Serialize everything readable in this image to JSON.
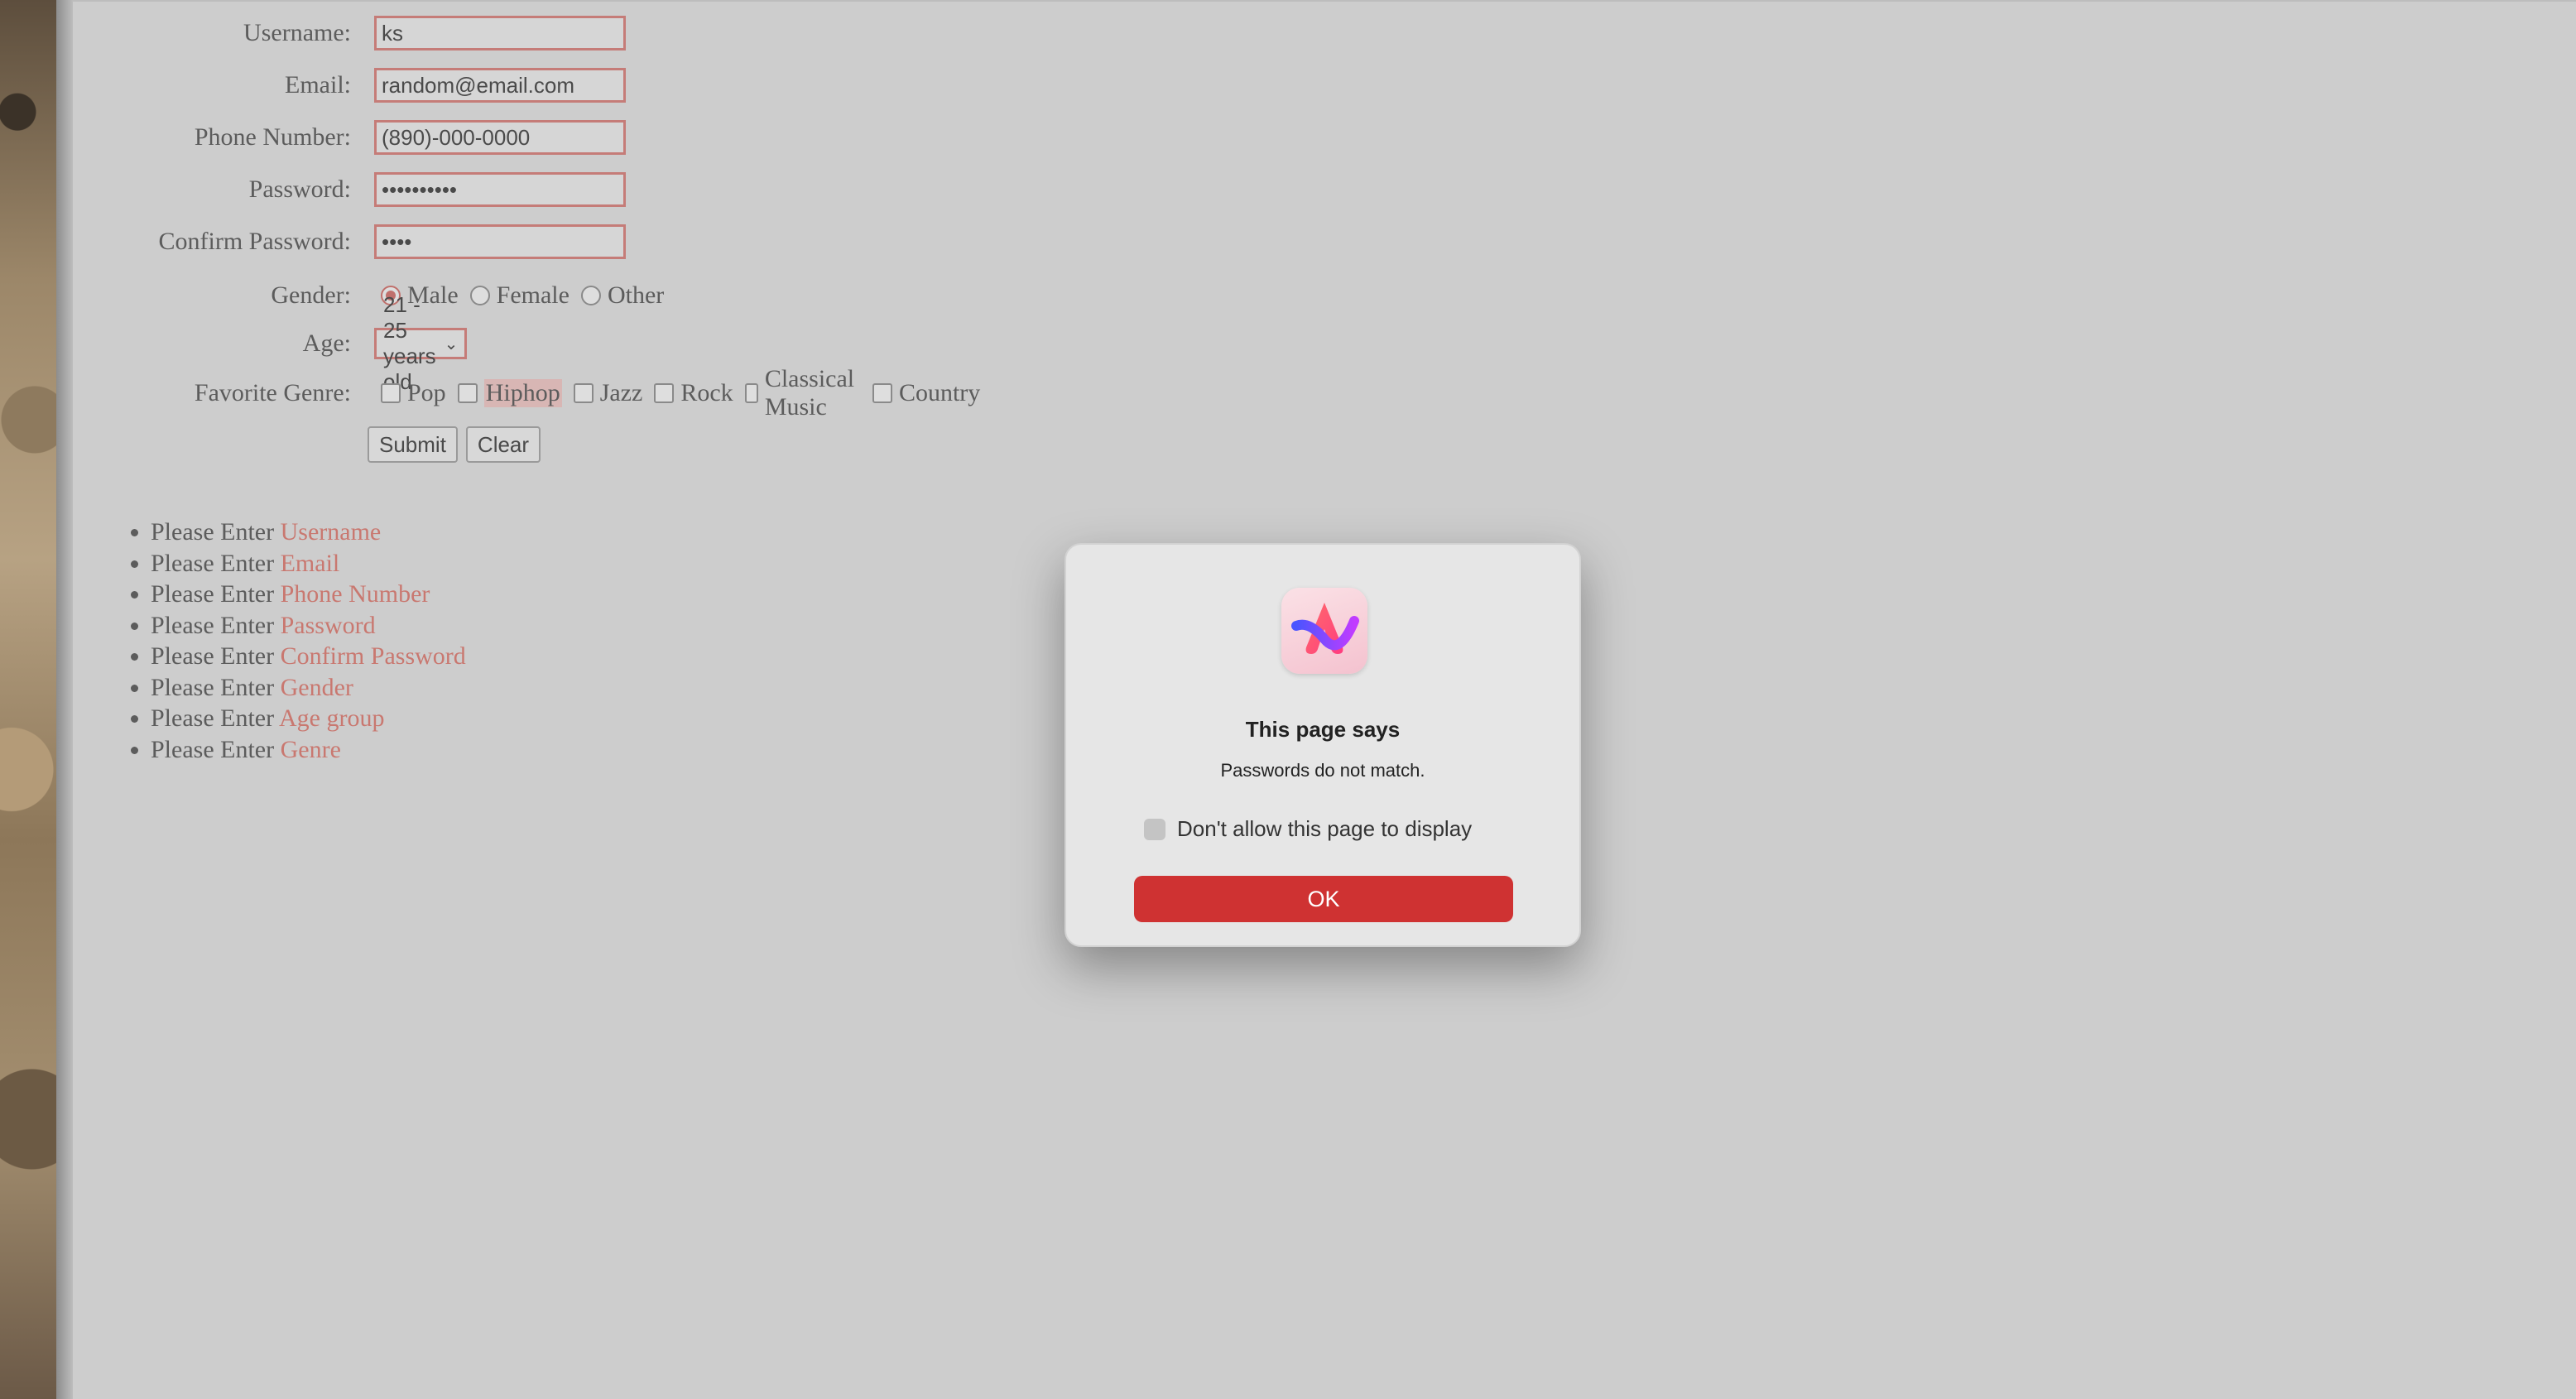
{
  "form": {
    "username_label": "Username:",
    "username_value": "ks",
    "email_label": "Email:",
    "email_value": "random@email.com",
    "phone_label": "Phone Number:",
    "phone_value": "(890)-000-0000",
    "password_label": "Password:",
    "password_value": "••••••••••",
    "confirm_label": "Confirm Password:",
    "confirm_value": "••••",
    "gender_label": "Gender:",
    "gender_options": [
      "Male",
      "Female",
      "Other"
    ],
    "gender_selected": "Male",
    "age_label": "Age:",
    "age_value": "21 - 25 years old",
    "genre_label": "Favorite Genre:",
    "genre_options": [
      "Pop",
      "Hiphop",
      "Jazz",
      "Rock",
      "Classical Music",
      "Country"
    ],
    "submit_label": "Submit",
    "clear_label": "Clear"
  },
  "errors": {
    "prefix": "Please Enter",
    "items": [
      "Username",
      "Email",
      "Phone Number",
      "Password",
      "Confirm Password",
      "Gender",
      "Age group",
      "Genre"
    ]
  },
  "dialog": {
    "title": "This page says",
    "message": "Passwords do not match.",
    "checkbox_label": "Don't allow this page to display",
    "ok_label": "OK",
    "icon": "arc-browser-icon"
  },
  "colors": {
    "error_accent": "#c97870",
    "ok_button": "#cf3232"
  }
}
